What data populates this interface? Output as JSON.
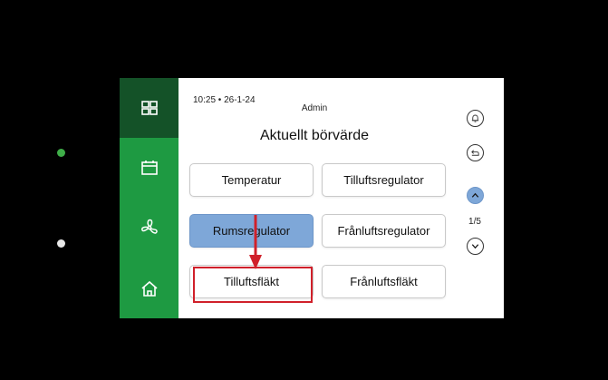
{
  "header": {
    "time": "10:25 • 26-1-24",
    "user": "Admin",
    "title": "Aktuellt börvärde"
  },
  "sidebar": {
    "items": [
      {
        "icon": "grid-icon",
        "active": true
      },
      {
        "icon": "calendar-icon",
        "active": false
      },
      {
        "icon": "fan-icon",
        "active": false
      },
      {
        "icon": "home-icon",
        "active": false
      }
    ]
  },
  "menu": {
    "buttons": [
      {
        "label": "Temperatur"
      },
      {
        "label": "Tilluftsregulator"
      },
      {
        "label": "Rumsregulator",
        "selected": true
      },
      {
        "label": "Frånluftsregulator"
      },
      {
        "label": "Tilluftsfläkt",
        "highlighted": true
      },
      {
        "label": "Frånluftsfläkt"
      }
    ]
  },
  "pager": {
    "indicator": "1/5"
  },
  "colors": {
    "sidebar": "#1e9a42",
    "sidebar_active": "#145228",
    "selected": "#7ea7d8",
    "highlight": "#d0202a"
  }
}
